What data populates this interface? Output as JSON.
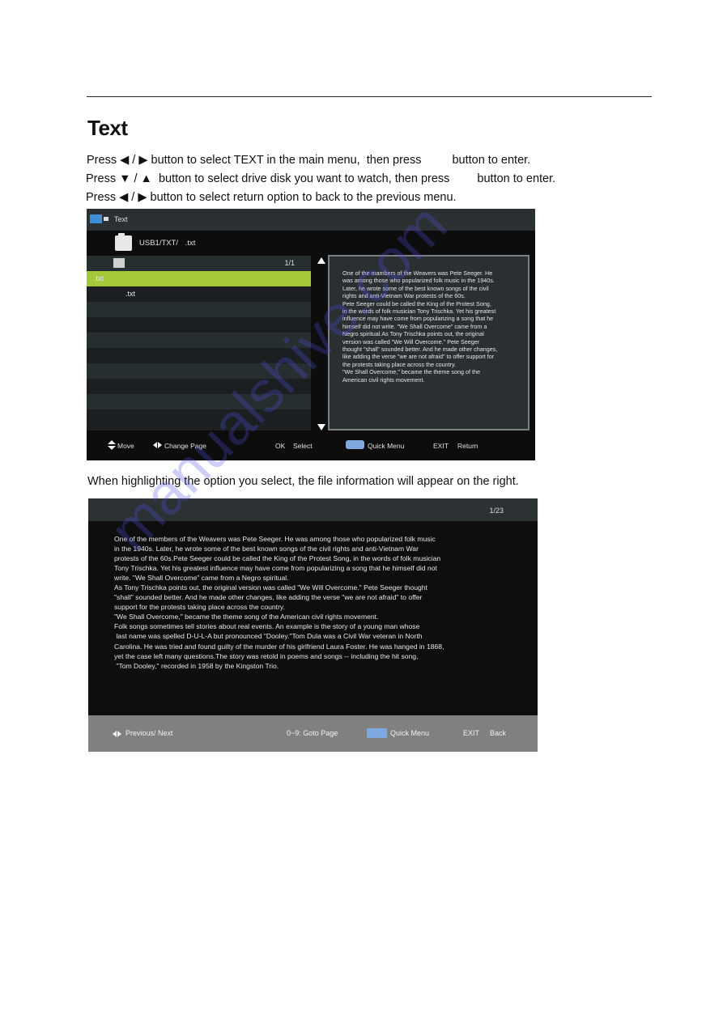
{
  "page": {
    "title": "Text",
    "instructions": [
      {
        "before": "Press ◀ / ▶ button to select TEXT in the main menu,  then press",
        "after": "button to enter."
      },
      {
        "before": "Press ▼ / ▲  button to select drive disk you want to watch, then press",
        "after": "button to enter."
      },
      {
        "before": "Press ◀ / ▶ button to select return option to back to the previous menu.",
        "after": ""
      }
    ],
    "caption": "When highlighting the option you select, the file information will appear on the right.",
    "watermark": "manualshive.com"
  },
  "screen1": {
    "header": {
      "icon": "usb-icon",
      "title": "Text"
    },
    "path": {
      "icon": "folder-icon",
      "text": "USB1/TXT/   .txt"
    },
    "list": {
      "page_count": "1/1",
      "up_icon": "parent-folder-icon",
      "items": [
        {
          "label": ".txt",
          "selected": true
        },
        {
          "label": ".txt",
          "selected": false
        }
      ]
    },
    "preview_text": "One of the mambers of the Weavers was Pete Seeger. He\nwas among those who popularized folk music in the 1940s.\nLater, he wrote some of the best known songs of the civil\nrights and anti-Vietnam War protests of the 60s.\nPete Seeger could be called the King of the Protest Song,\nin the words of folk musician Tony Trischka. Yet his greatest\ninfluence may have come from popularizing a song that he\nhimself did not write. \"We Shall Overcome\" came from a\nNegro spiritual.As Tony Trischka points out, the original\nversion was called \"We Will Overcome.\" Pete Seeger\nthought \"shall\" sounded better. And he made other changes,\nlike adding the verse \"we are not afraid\" to offer support for\nthe protests taking place across the country.\n\"We Shall Overcome,\" became the theme song of the\nAmerican civil rights movement.",
    "footer": {
      "move": "Move",
      "change_page": "Change Page",
      "ok_key": "OK",
      "ok_label": "Select",
      "quick_menu": "Quick Menu",
      "exit_key": "EXIT",
      "exit_label": "Return"
    }
  },
  "screen2": {
    "page_indicator": "1/23",
    "body_text": "One of the members of the Weavers was Pete Seeger. He was among those who popularized folk music\nin the 1940s. Later, he wrote some of the best known songs of the civil rights and anti-Vietnam War\nprotests of the 60s.Pete Seeger could be called the King of the Protest Song, in the words of folk musician\nTony Trischka. Yet his greatest influence may have come from popularizing a song that he himself did not\nwrite. \"We Shall Overcome\" came from a Negro spiritual.\nAs Tony Trischka points out, the original version was called \"We Will Overcome.\" Pete Seeger thought\n\"shall\" sounded better. And he made other changes, like adding the verse \"we are not afraid\" to offer\nsupport for the protests taking place across the country.\n\"We Shall Overcome,\" became the theme song of the American civil rights movement.\nFolk songs sometimes tell stories about real events. An example is the story of a young man whose\n last name was spelled D-U-L-A but pronounced \"Dooley.\"Tom Dula was a Civil War veteran in North\nCarolina. He was tried and found guilty of the murder of his girlfriend Laura Foster. He was hanged in 1868,\nyet the case left many questions.The story was retold in poems and songs -- including the hit song,\n \"Tom Dooley,\" recorded in 1958 by the Kingston Trio.",
    "footer": {
      "prev_next": "Previous/ Next",
      "goto": "0~9: Goto Page",
      "quick_menu": "Quick Menu",
      "exit_key": "EXIT",
      "exit_label": "Back"
    }
  },
  "colors": {
    "selection": "#a3c93a",
    "quick_menu_key": "#7fa8e0",
    "usb_icon": "#3f8fd8"
  }
}
